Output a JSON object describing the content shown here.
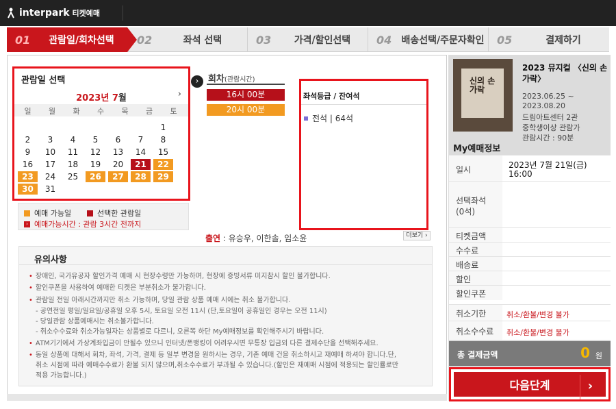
{
  "brand": {
    "name": "interpark",
    "sub": "티켓예매"
  },
  "steps": [
    {
      "num": "01",
      "label": "관람일/회차선택",
      "active": true
    },
    {
      "num": "02",
      "label": "좌석 선택",
      "active": false
    },
    {
      "num": "03",
      "label": "가격/할인선택",
      "active": false
    },
    {
      "num": "04",
      "label": "배송선택/주문자확인",
      "active": false
    },
    {
      "num": "05",
      "label": "결제하기",
      "active": false
    }
  ],
  "calendar": {
    "title": "관람일 선택",
    "year": "2023",
    "year_suffix": "년 ",
    "month": "7",
    "month_suffix": "월",
    "next": "›",
    "weekdays": [
      "일",
      "월",
      "화",
      "수",
      "목",
      "금",
      "토"
    ],
    "first_weekday": 6,
    "days": 31,
    "available": [
      22,
      23,
      26,
      27,
      28,
      29,
      30
    ],
    "selected": 21
  },
  "legend": {
    "available": "예매 가능일",
    "selected": "선택한 관람일",
    "deadline": "예매가능시간 : 관람 3시간 전까지",
    "colors": {
      "available": "#f29a21",
      "selected": "#b6101a"
    }
  },
  "times": {
    "title": "회차",
    "subtitle": "(관람시간)",
    "slots": [
      {
        "label": "16시 00분",
        "color": "#b6101a"
      },
      {
        "label": "20시 00분",
        "color": "#f29a21"
      }
    ]
  },
  "grade": {
    "title": "좌석등급 / 잔여석",
    "items": [
      {
        "label": "전석 | 64석"
      }
    ]
  },
  "cast": {
    "label": "출연",
    "names": "유승우, 이한솔, 임소윤",
    "more": "더보기 ›"
  },
  "notice": {
    "title": "유의사항",
    "lines": [
      "장애인, 국가유공자 할인가격 예매 시 현장수령만 가능하며, 현장에 증빙서류 미지참시 할인 불가합니다.",
      "할인쿠폰을 사용하여 예매한 티켓은 부분취소가 불가합니다.",
      "관람일 전일 아래시간까지만 취소 가능하며, 당일 관람 상품 예매 시에는 취소 불가합니다.",
      "- 공연전일 평일/일요일/공휴일 오후 5시, 토요일 오전 11시 (단,토요일이 공휴일인 경우는 오전 11시)",
      "- 당일관람 상품예매시는 취소불가합니다.",
      "- 취소수수료와 취소가능일자는 상품별로 다르니, 오른쪽 하단 My예매정보를 확인해주시기 바랍니다.",
      "ATM기기에서 가상계좌입금이 안될수 있으니 인터넷/폰뱅킹이 어려우시면 무통장 입금외 다른 결제수단을 선택해주세요.",
      "동일 상품에 대해서 회차, 좌석, 가격, 결제 등 일부 변경을 원하시는 경우, 기존 예매 건을 취소하시고 재예매 하셔야 합니다.단,",
      "취소 시점에 따라 예매수수료가 환불 되지 않으며,취소수수료가 부과될 수 있습니다.(할인은 재예매 시점에 적용되는 할인률로만",
      "적용 가능합니다.)"
    ]
  },
  "show": {
    "title": "2023 뮤지컬 〈신의 손가락〉",
    "period": "2023.06.25 ~",
    "period_end": "2023.08.20",
    "venue": "드림아트센터 2관",
    "age": "중학생이상 관람가",
    "runtime": "관람시간 : 90분",
    "poster_text": "신의 손가락"
  },
  "my": {
    "title": "My예매정보",
    "date_label": "일시",
    "date_value": "2023년 7월 21일(금)",
    "time_value": "16:00",
    "seat_label": "선택좌석",
    "seat_count": "(0석)",
    "ticket_label": "티켓금액",
    "fee_label": "수수료",
    "delivery_label": "배송료",
    "discount_label": "할인",
    "coupon_label": "할인쿠폰",
    "cancel_deadline_label": "취소기한",
    "cancel_deadline_value": "취소/환불/변경 불가",
    "cancel_fee_label": "취소수수료",
    "cancel_fee_value": "취소/환불/변경 불가",
    "total_label": "총 결제금액",
    "total_value": "0",
    "total_unit": "원"
  },
  "next_button": {
    "label": "다음단계",
    "chevron": "›"
  }
}
